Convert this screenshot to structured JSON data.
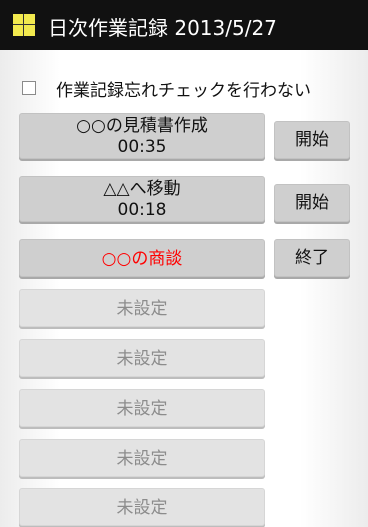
{
  "title_bar": {
    "title": "日次作業記録 2013/5/27",
    "icon": "app-icon"
  },
  "option": {
    "label": "作業記録忘れチェックを行わない",
    "checked": false
  },
  "tasks": [
    {
      "name": "○○の見積書作成",
      "time": "00:35",
      "state": "idle",
      "action": "開始"
    },
    {
      "name": "△△へ移動",
      "time": "00:18",
      "state": "idle",
      "action": "開始"
    },
    {
      "name": "○○の商談",
      "time": "",
      "state": "running",
      "action": "終了"
    },
    {
      "name": "未設定"
    },
    {
      "name": "未設定"
    },
    {
      "name": "未設定"
    },
    {
      "name": "未設定"
    },
    {
      "name": "未設定"
    }
  ],
  "colors": {
    "running_text": "#ff0000",
    "unset_text": "#8c8c8c",
    "title_bar": "#111111"
  }
}
